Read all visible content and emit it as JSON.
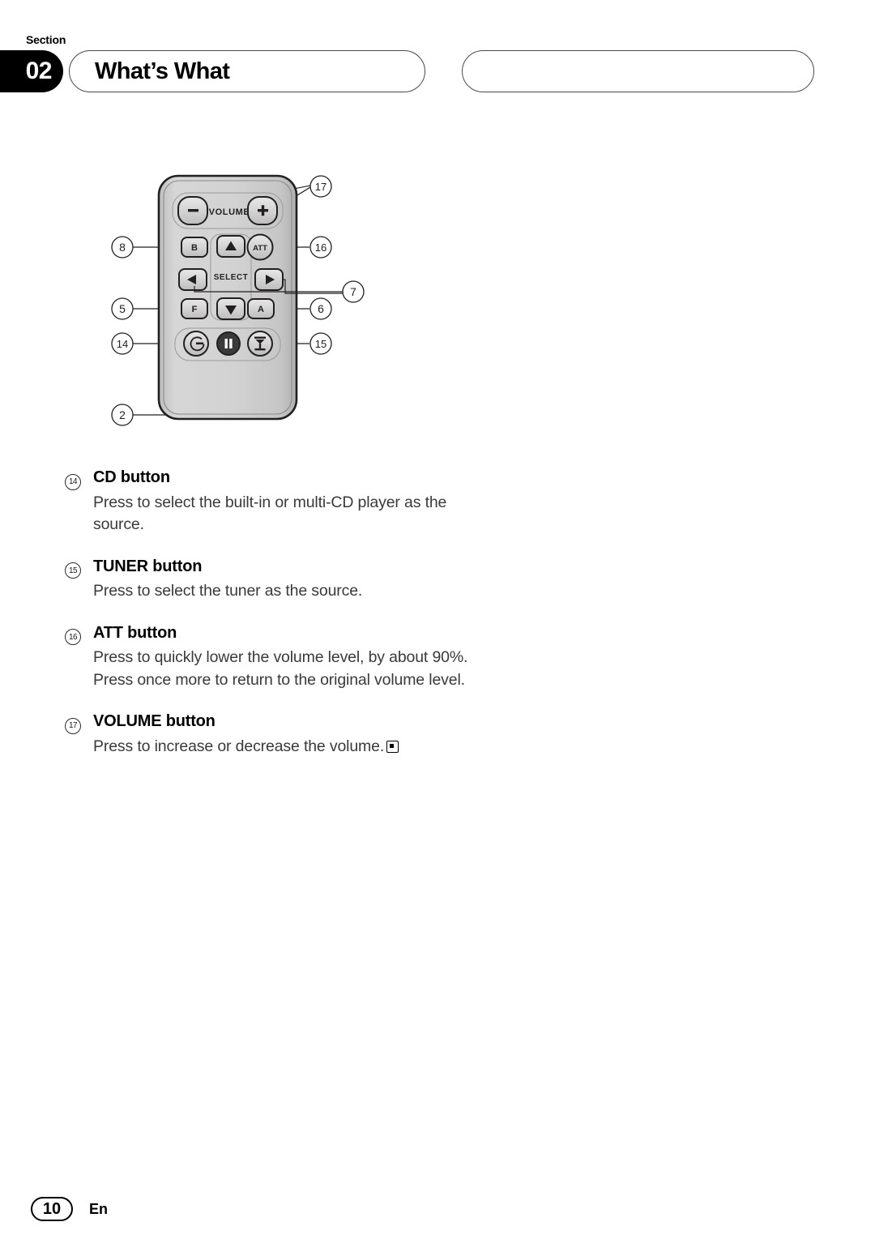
{
  "header": {
    "section_label": "Section",
    "section_number": "02",
    "title": "What’s What"
  },
  "diagram": {
    "name": "remote-control-illustration",
    "device": "car-audio-remote-control",
    "labels": {
      "volume": "VOLUME",
      "select": "SELECT",
      "att": "ATT",
      "b": "B",
      "f": "F",
      "a": "A",
      "minus": "−",
      "plus": "+"
    },
    "callouts": [
      {
        "id": "callout-17",
        "number": "17",
        "side": "right"
      },
      {
        "id": "callout-16",
        "number": "16",
        "side": "right"
      },
      {
        "id": "callout-7",
        "number": "7",
        "side": "right"
      },
      {
        "id": "callout-6",
        "number": "6",
        "side": "right"
      },
      {
        "id": "callout-15",
        "number": "15",
        "side": "right"
      },
      {
        "id": "callout-8",
        "number": "8",
        "side": "left"
      },
      {
        "id": "callout-5",
        "number": "5",
        "side": "left"
      },
      {
        "id": "callout-14",
        "number": "14",
        "side": "left"
      },
      {
        "id": "callout-2",
        "number": "2",
        "side": "left"
      }
    ]
  },
  "entries": [
    {
      "number": "14",
      "title": "CD button",
      "body": "Press to select the built-in or multi-CD player as the source."
    },
    {
      "number": "15",
      "title": "TUNER button",
      "body": "Press to select the tuner as the source."
    },
    {
      "number": "16",
      "title": "ATT button",
      "body": "Press to quickly lower the volume level, by about 90%. Press once more to return to the original volume level."
    },
    {
      "number": "17",
      "title": "VOLUME button",
      "body": "Press to increase or decrease the volume."
    }
  ],
  "footer": {
    "page_number": "10",
    "language": "En"
  },
  "colors": {
    "ink": "#000000",
    "body_text": "#3a3a3a",
    "rule": "#4a4a4a",
    "remote_body": "#d2d2d2",
    "remote_outline": "#231f20"
  }
}
